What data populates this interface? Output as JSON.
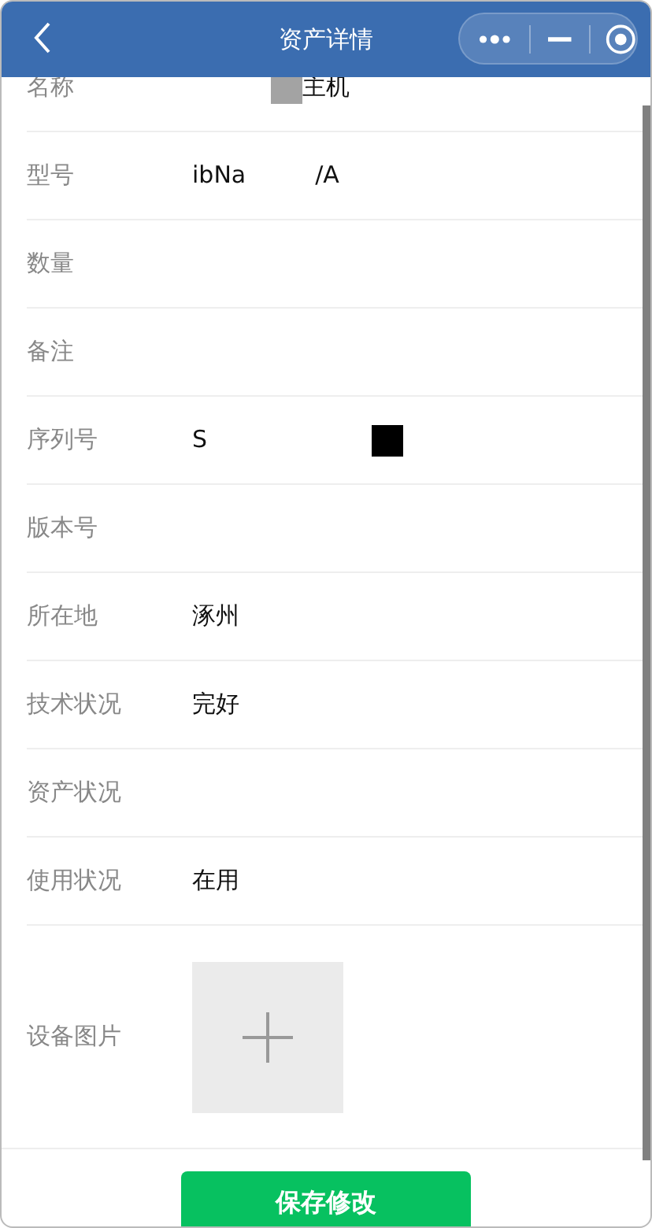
{
  "header": {
    "title": "资产详情"
  },
  "fields": [
    {
      "label": "名称",
      "values": [
        {
          "kind": "block"
        },
        {
          "kind": "text",
          "text": "主机"
        }
      ]
    },
    {
      "label": "型号",
      "values": [
        {
          "kind": "text",
          "text": "ibNa"
        },
        {
          "kind": "text",
          "text": "/A"
        }
      ]
    },
    {
      "label": "数量"
    },
    {
      "label": "备注"
    },
    {
      "label": "序列号",
      "values": [
        {
          "kind": "text",
          "text": "S"
        },
        {
          "kind": "block"
        }
      ]
    },
    {
      "label": "版本号"
    },
    {
      "label": "所在地",
      "values": [
        {
          "kind": "text",
          "text": "涿州"
        }
      ]
    },
    {
      "label": "技术状况",
      "values": [
        {
          "kind": "text",
          "text": "完好"
        }
      ]
    },
    {
      "label": "资产状况"
    },
    {
      "label": "使用状况",
      "values": [
        {
          "kind": "text",
          "text": "在用"
        }
      ]
    }
  ],
  "photo": {
    "label": "设备图片"
  },
  "save_button": "保存修改"
}
